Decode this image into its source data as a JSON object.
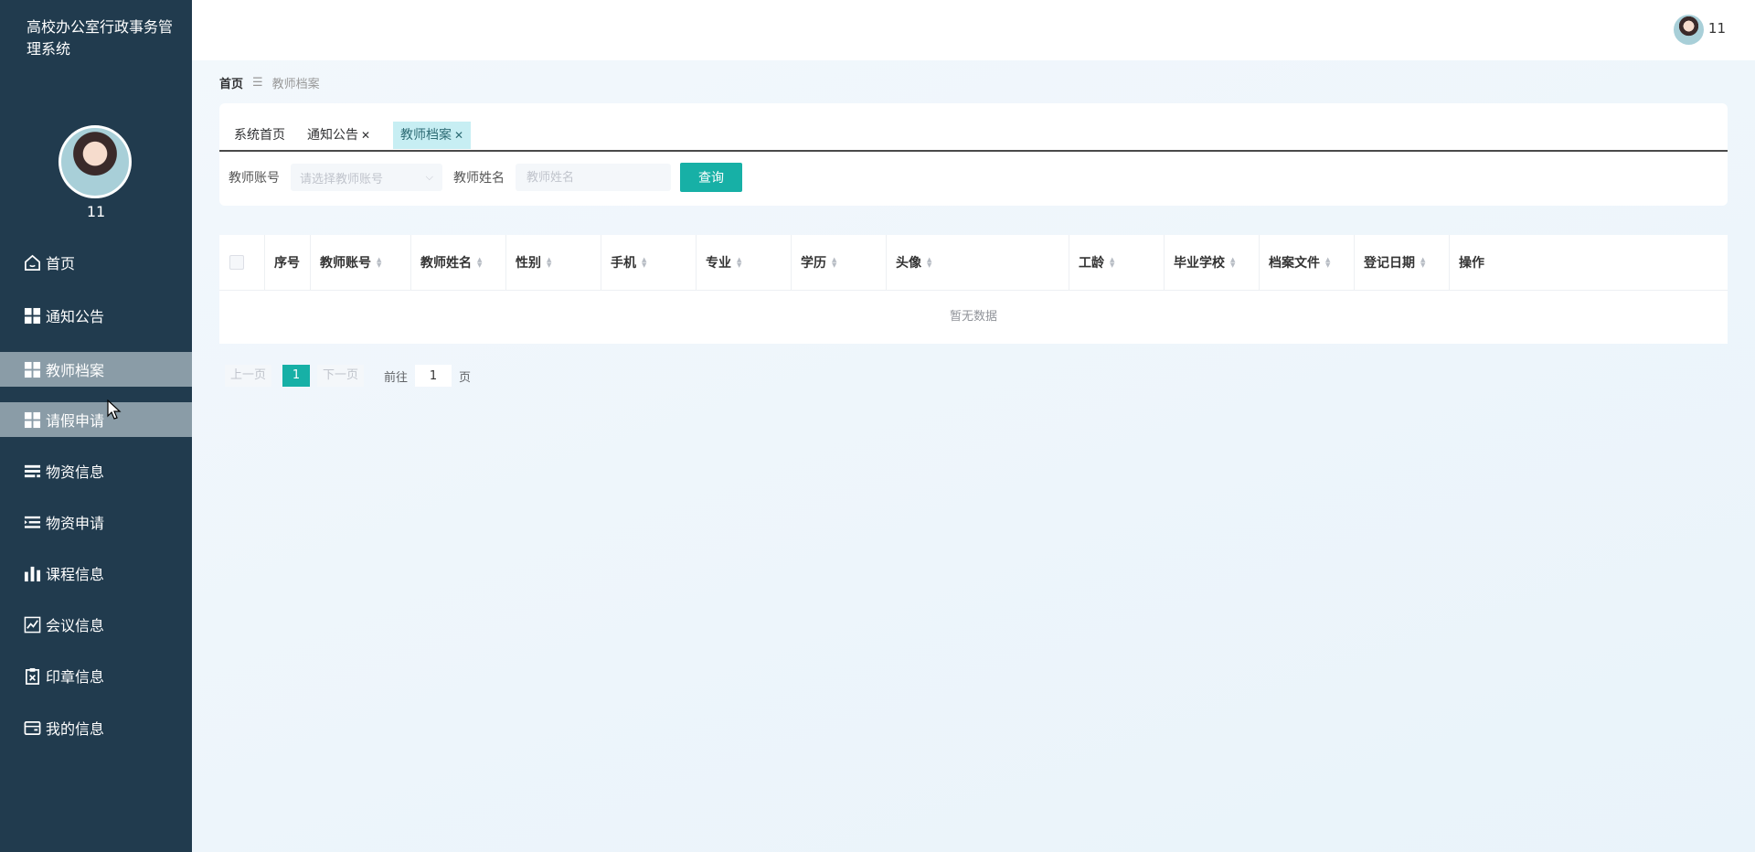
{
  "sidebar": {
    "title": "高校办公室行政事务管理系统",
    "username": "11",
    "menu": [
      {
        "label": "首页",
        "icon": "home-icon"
      },
      {
        "label": "通知公告",
        "icon": "grid-icon"
      },
      {
        "label": "教师档案",
        "icon": "grid-icon"
      },
      {
        "label": "请假申请",
        "icon": "grid-icon"
      },
      {
        "label": "物资信息",
        "icon": "list-icon"
      },
      {
        "label": "物资申请",
        "icon": "list-indent-icon"
      },
      {
        "label": "课程信息",
        "icon": "bar-chart-icon"
      },
      {
        "label": "会议信息",
        "icon": "line-chart-icon"
      },
      {
        "label": "印章信息",
        "icon": "clipboard-icon"
      },
      {
        "label": "我的信息",
        "icon": "wallet-icon"
      }
    ]
  },
  "header": {
    "username": "11"
  },
  "breadcrumb": {
    "home": "首页",
    "separator": "☰",
    "current": "教师档案"
  },
  "tabs": [
    {
      "label": "系统首页",
      "closable": false
    },
    {
      "label": "通知公告",
      "closable": true
    },
    {
      "label": "教师档案",
      "closable": true,
      "active": true
    }
  ],
  "search": {
    "account_label": "教师账号",
    "account_placeholder": "请选择教师账号",
    "name_label": "教师姓名",
    "name_placeholder": "教师姓名",
    "query_button": "查询"
  },
  "table": {
    "columns": [
      "序号",
      "教师账号",
      "教师姓名",
      "性别",
      "手机",
      "专业",
      "学历",
      "头像",
      "工龄",
      "毕业学校",
      "档案文件",
      "登记日期",
      "操作"
    ],
    "empty_text": "暂无数据"
  },
  "pagination": {
    "prev": "上一页",
    "current_page": "1",
    "next": "下一页",
    "goto_label": "前往",
    "goto_value": "1",
    "page_unit": "页"
  },
  "colors": {
    "sidebar_bg": "#213b4e",
    "accent": "#17b0a6",
    "active_tab_bg": "#c7eef3",
    "menu_highlight": "#8a9ca7"
  }
}
